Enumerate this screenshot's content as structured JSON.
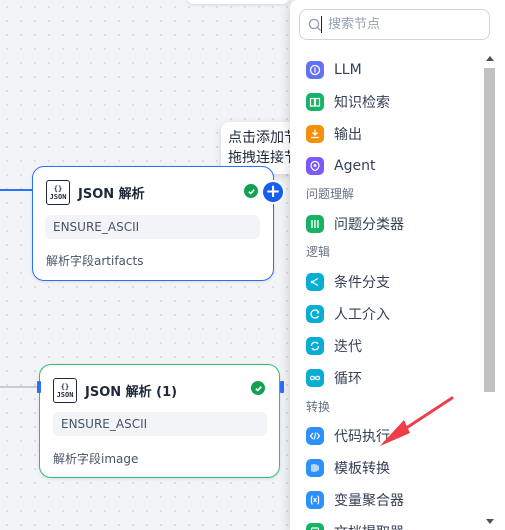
{
  "canvas": {
    "tooltip": {
      "line1": "点击添加节点",
      "line2": "拖拽连接节点"
    }
  },
  "nodes": [
    {
      "title": "JSON 解析",
      "variable": "ENSURE_ASCII",
      "description": "解析字段artifacts",
      "status": "success"
    },
    {
      "title": "JSON 解析 (1)",
      "variable": "ENSURE_ASCII",
      "description": "解析字段image",
      "status": "success"
    }
  ],
  "json_icon": {
    "line1": "{}",
    "line2": "JSON"
  },
  "node_picker": {
    "search_placeholder": "搜索节点",
    "items": [
      {
        "label": "LLM",
        "icon": "llm-icon",
        "color": "#6172f3"
      },
      {
        "label": "知识检索",
        "icon": "knowledge-retrieval-icon",
        "color": "#16b364"
      },
      {
        "label": "输出",
        "icon": "answer-icon",
        "color": "#f79009"
      },
      {
        "label": "Agent",
        "icon": "agent-icon",
        "color": "#7a5af8"
      }
    ],
    "groups": [
      {
        "title": "问题理解",
        "items": [
          {
            "label": "问题分类器",
            "icon": "question-classifier-icon",
            "color": "#16b364"
          }
        ]
      },
      {
        "title": "逻辑",
        "items": [
          {
            "label": "条件分支",
            "icon": "if-else-icon",
            "color": "#06aed4"
          },
          {
            "label": "人工介入",
            "icon": "human-input-icon",
            "color": "#06aed4"
          },
          {
            "label": "迭代",
            "icon": "iteration-icon",
            "color": "#06aed4"
          },
          {
            "label": "循环",
            "icon": "loop-icon",
            "color": "#06aed4"
          }
        ]
      },
      {
        "title": "转换",
        "items": [
          {
            "label": "代码执行",
            "icon": "code-icon",
            "color": "#2e90fa"
          },
          {
            "label": "模板转换",
            "icon": "template-transform-icon",
            "color": "#2e90fa"
          },
          {
            "label": "变量聚合器",
            "icon": "variable-aggregator-icon",
            "color": "#2e90fa"
          },
          {
            "label": "文档提取器",
            "icon": "doc-extractor-icon",
            "color": "#16b364"
          }
        ]
      }
    ]
  },
  "colors": {
    "accent": "#2970ff",
    "success": "#12a150",
    "annotation": "#ef3e4a"
  }
}
